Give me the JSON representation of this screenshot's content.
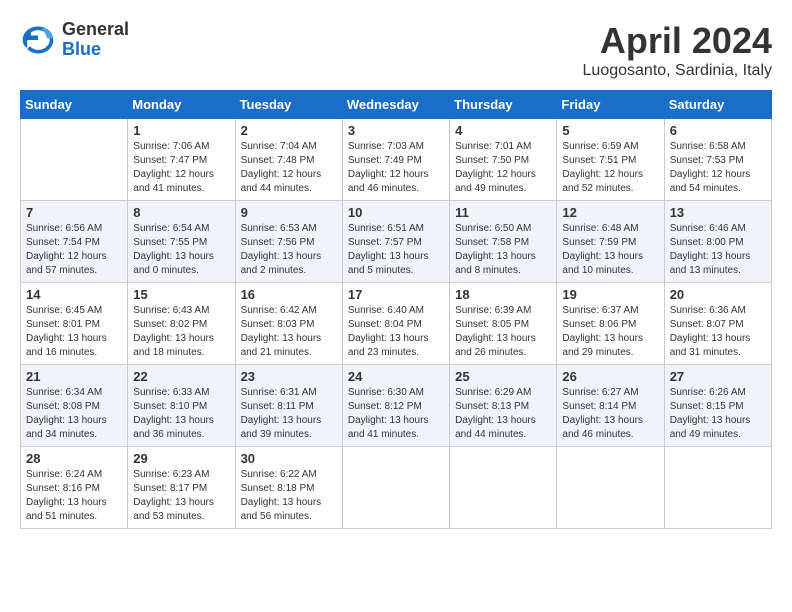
{
  "header": {
    "logo_general": "General",
    "logo_blue": "Blue",
    "month_title": "April 2024",
    "location": "Luogosanto, Sardinia, Italy"
  },
  "days_of_week": [
    "Sunday",
    "Monday",
    "Tuesday",
    "Wednesday",
    "Thursday",
    "Friday",
    "Saturday"
  ],
  "weeks": [
    [
      {
        "day": "",
        "sunrise": "",
        "sunset": "",
        "daylight": ""
      },
      {
        "day": "1",
        "sunrise": "Sunrise: 7:06 AM",
        "sunset": "Sunset: 7:47 PM",
        "daylight": "Daylight: 12 hours and 41 minutes."
      },
      {
        "day": "2",
        "sunrise": "Sunrise: 7:04 AM",
        "sunset": "Sunset: 7:48 PM",
        "daylight": "Daylight: 12 hours and 44 minutes."
      },
      {
        "day": "3",
        "sunrise": "Sunrise: 7:03 AM",
        "sunset": "Sunset: 7:49 PM",
        "daylight": "Daylight: 12 hours and 46 minutes."
      },
      {
        "day": "4",
        "sunrise": "Sunrise: 7:01 AM",
        "sunset": "Sunset: 7:50 PM",
        "daylight": "Daylight: 12 hours and 49 minutes."
      },
      {
        "day": "5",
        "sunrise": "Sunrise: 6:59 AM",
        "sunset": "Sunset: 7:51 PM",
        "daylight": "Daylight: 12 hours and 52 minutes."
      },
      {
        "day": "6",
        "sunrise": "Sunrise: 6:58 AM",
        "sunset": "Sunset: 7:53 PM",
        "daylight": "Daylight: 12 hours and 54 minutes."
      }
    ],
    [
      {
        "day": "7",
        "sunrise": "Sunrise: 6:56 AM",
        "sunset": "Sunset: 7:54 PM",
        "daylight": "Daylight: 12 hours and 57 minutes."
      },
      {
        "day": "8",
        "sunrise": "Sunrise: 6:54 AM",
        "sunset": "Sunset: 7:55 PM",
        "daylight": "Daylight: 13 hours and 0 minutes."
      },
      {
        "day": "9",
        "sunrise": "Sunrise: 6:53 AM",
        "sunset": "Sunset: 7:56 PM",
        "daylight": "Daylight: 13 hours and 2 minutes."
      },
      {
        "day": "10",
        "sunrise": "Sunrise: 6:51 AM",
        "sunset": "Sunset: 7:57 PM",
        "daylight": "Daylight: 13 hours and 5 minutes."
      },
      {
        "day": "11",
        "sunrise": "Sunrise: 6:50 AM",
        "sunset": "Sunset: 7:58 PM",
        "daylight": "Daylight: 13 hours and 8 minutes."
      },
      {
        "day": "12",
        "sunrise": "Sunrise: 6:48 AM",
        "sunset": "Sunset: 7:59 PM",
        "daylight": "Daylight: 13 hours and 10 minutes."
      },
      {
        "day": "13",
        "sunrise": "Sunrise: 6:46 AM",
        "sunset": "Sunset: 8:00 PM",
        "daylight": "Daylight: 13 hours and 13 minutes."
      }
    ],
    [
      {
        "day": "14",
        "sunrise": "Sunrise: 6:45 AM",
        "sunset": "Sunset: 8:01 PM",
        "daylight": "Daylight: 13 hours and 16 minutes."
      },
      {
        "day": "15",
        "sunrise": "Sunrise: 6:43 AM",
        "sunset": "Sunset: 8:02 PM",
        "daylight": "Daylight: 13 hours and 18 minutes."
      },
      {
        "day": "16",
        "sunrise": "Sunrise: 6:42 AM",
        "sunset": "Sunset: 8:03 PM",
        "daylight": "Daylight: 13 hours and 21 minutes."
      },
      {
        "day": "17",
        "sunrise": "Sunrise: 6:40 AM",
        "sunset": "Sunset: 8:04 PM",
        "daylight": "Daylight: 13 hours and 23 minutes."
      },
      {
        "day": "18",
        "sunrise": "Sunrise: 6:39 AM",
        "sunset": "Sunset: 8:05 PM",
        "daylight": "Daylight: 13 hours and 26 minutes."
      },
      {
        "day": "19",
        "sunrise": "Sunrise: 6:37 AM",
        "sunset": "Sunset: 8:06 PM",
        "daylight": "Daylight: 13 hours and 29 minutes."
      },
      {
        "day": "20",
        "sunrise": "Sunrise: 6:36 AM",
        "sunset": "Sunset: 8:07 PM",
        "daylight": "Daylight: 13 hours and 31 minutes."
      }
    ],
    [
      {
        "day": "21",
        "sunrise": "Sunrise: 6:34 AM",
        "sunset": "Sunset: 8:08 PM",
        "daylight": "Daylight: 13 hours and 34 minutes."
      },
      {
        "day": "22",
        "sunrise": "Sunrise: 6:33 AM",
        "sunset": "Sunset: 8:10 PM",
        "daylight": "Daylight: 13 hours and 36 minutes."
      },
      {
        "day": "23",
        "sunrise": "Sunrise: 6:31 AM",
        "sunset": "Sunset: 8:11 PM",
        "daylight": "Daylight: 13 hours and 39 minutes."
      },
      {
        "day": "24",
        "sunrise": "Sunrise: 6:30 AM",
        "sunset": "Sunset: 8:12 PM",
        "daylight": "Daylight: 13 hours and 41 minutes."
      },
      {
        "day": "25",
        "sunrise": "Sunrise: 6:29 AM",
        "sunset": "Sunset: 8:13 PM",
        "daylight": "Daylight: 13 hours and 44 minutes."
      },
      {
        "day": "26",
        "sunrise": "Sunrise: 6:27 AM",
        "sunset": "Sunset: 8:14 PM",
        "daylight": "Daylight: 13 hours and 46 minutes."
      },
      {
        "day": "27",
        "sunrise": "Sunrise: 6:26 AM",
        "sunset": "Sunset: 8:15 PM",
        "daylight": "Daylight: 13 hours and 49 minutes."
      }
    ],
    [
      {
        "day": "28",
        "sunrise": "Sunrise: 6:24 AM",
        "sunset": "Sunset: 8:16 PM",
        "daylight": "Daylight: 13 hours and 51 minutes."
      },
      {
        "day": "29",
        "sunrise": "Sunrise: 6:23 AM",
        "sunset": "Sunset: 8:17 PM",
        "daylight": "Daylight: 13 hours and 53 minutes."
      },
      {
        "day": "30",
        "sunrise": "Sunrise: 6:22 AM",
        "sunset": "Sunset: 8:18 PM",
        "daylight": "Daylight: 13 hours and 56 minutes."
      },
      {
        "day": "",
        "sunrise": "",
        "sunset": "",
        "daylight": ""
      },
      {
        "day": "",
        "sunrise": "",
        "sunset": "",
        "daylight": ""
      },
      {
        "day": "",
        "sunrise": "",
        "sunset": "",
        "daylight": ""
      },
      {
        "day": "",
        "sunrise": "",
        "sunset": "",
        "daylight": ""
      }
    ]
  ]
}
